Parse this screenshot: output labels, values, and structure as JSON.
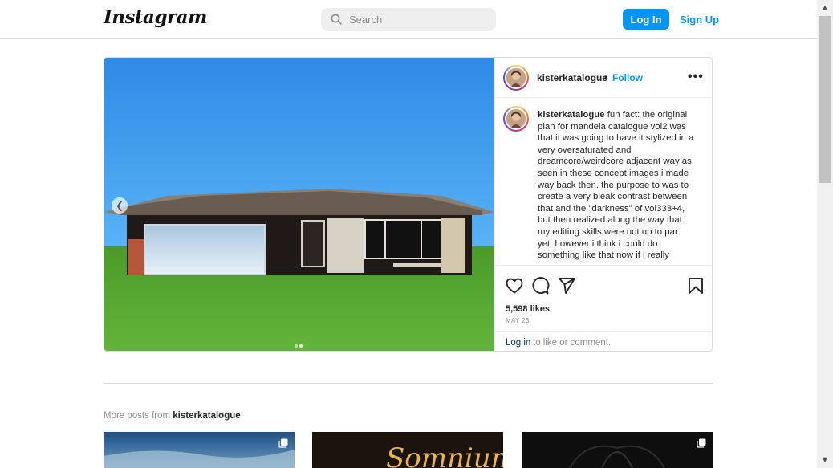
{
  "nav": {
    "logo": "Instagram",
    "search_placeholder": "Search",
    "login_label": "Log In",
    "signup_label": "Sign Up"
  },
  "post": {
    "username": "kisterkatalogue",
    "separator": "•",
    "follow_label": "Follow",
    "more_options": "•••",
    "caption_username": "kisterkatalogue",
    "caption_text": " fun fact: the original plan for mandela catalogue vol2 was that it was going to have it stylized in a very oversaturated and dreamcore/weirdcore adjacent way as seen in these concept images i made way back then. the purpose to was to create a very bleak contrast between that and the \"darkness\" of vol333+4, but then realized along the way that my editing skills were not up to par yet. however i think i could do something like that now if i really",
    "likes": "5,598 likes",
    "date": "MAY 23",
    "login_link": "Log in",
    "login_rest": " to like or comment.",
    "carousel": {
      "current": 2,
      "total": 2
    },
    "icons": [
      "heart-icon",
      "comment-icon",
      "share-icon",
      "bookmark-icon",
      "chevron-left-icon"
    ]
  },
  "more_posts": {
    "prefix": "More posts from ",
    "username": "kisterkatalogue",
    "thumbnails": [
      {
        "text": ""
      },
      {
        "text": "Somnium"
      },
      {
        "text": ""
      }
    ]
  },
  "scrollbar": {
    "up_icon": "▲",
    "down_icon": "▼"
  },
  "colors": {
    "accent": "#0095f6",
    "border": "#dbdbdb",
    "muted": "#8e8e8e"
  }
}
